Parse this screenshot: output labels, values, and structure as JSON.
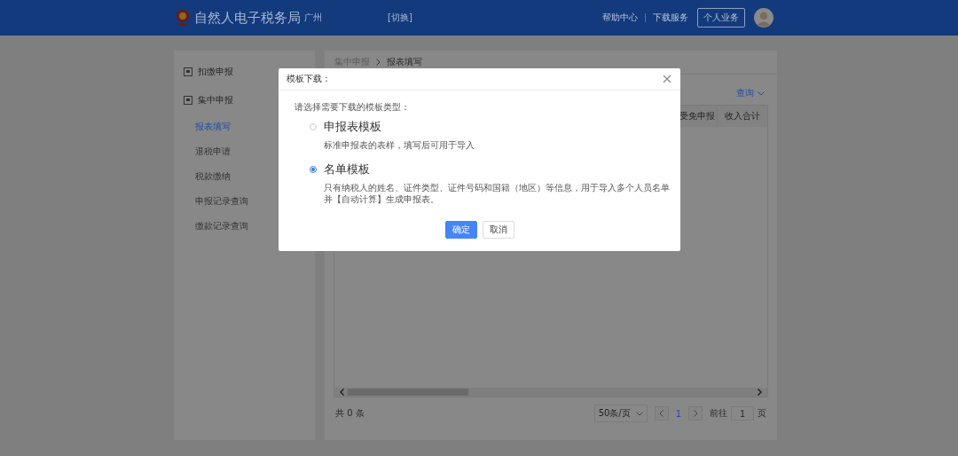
{
  "header": {
    "title": "自然人电子税务局",
    "region": "广州",
    "switch": "[切换]",
    "links": [
      "帮助中心",
      "下载服务"
    ],
    "account_button": "个人业务"
  },
  "sidebar": {
    "items": [
      {
        "kind": "group",
        "label": "扣缴申报",
        "expanded": false
      },
      {
        "kind": "group",
        "label": "集中申报",
        "expanded": true
      },
      {
        "kind": "sub",
        "label": "报表填写",
        "selected": true
      },
      {
        "kind": "sub",
        "label": "退税申请",
        "selected": false
      },
      {
        "kind": "sub",
        "label": "税款缴纳",
        "selected": false
      },
      {
        "kind": "sub",
        "label": "申报记录查询",
        "selected": false
      },
      {
        "kind": "sub",
        "label": "缴款记录查询",
        "selected": false
      }
    ]
  },
  "breadcrumb": [
    "集中申报",
    "报表填写"
  ],
  "query_link": "查询",
  "table": {
    "columns": [
      "受免申报",
      "收入合计"
    ]
  },
  "pagination": {
    "total": "共 0 条",
    "page_size": "50条/页",
    "current_page": "1",
    "goto_label": "前往",
    "goto_value": "1",
    "page_suffix": "页"
  },
  "dialog": {
    "title": "模板下载：",
    "prompt": "请选择需要下载的模板类型：",
    "options": [
      {
        "label": "申报表模板",
        "description": "标准申报表的表样，填写后可用于导入",
        "selected": false
      },
      {
        "label": "名单模板",
        "description": "只有纳税人的姓名、证件类型、证件号码和国籍（地区）等信息，用于导入多个人员名单并【自动计算】生成申报表。",
        "selected": true
      }
    ],
    "buttons": [
      {
        "kind": "primary",
        "label": "确定"
      },
      {
        "kind": "default",
        "label": "取消"
      }
    ]
  }
}
